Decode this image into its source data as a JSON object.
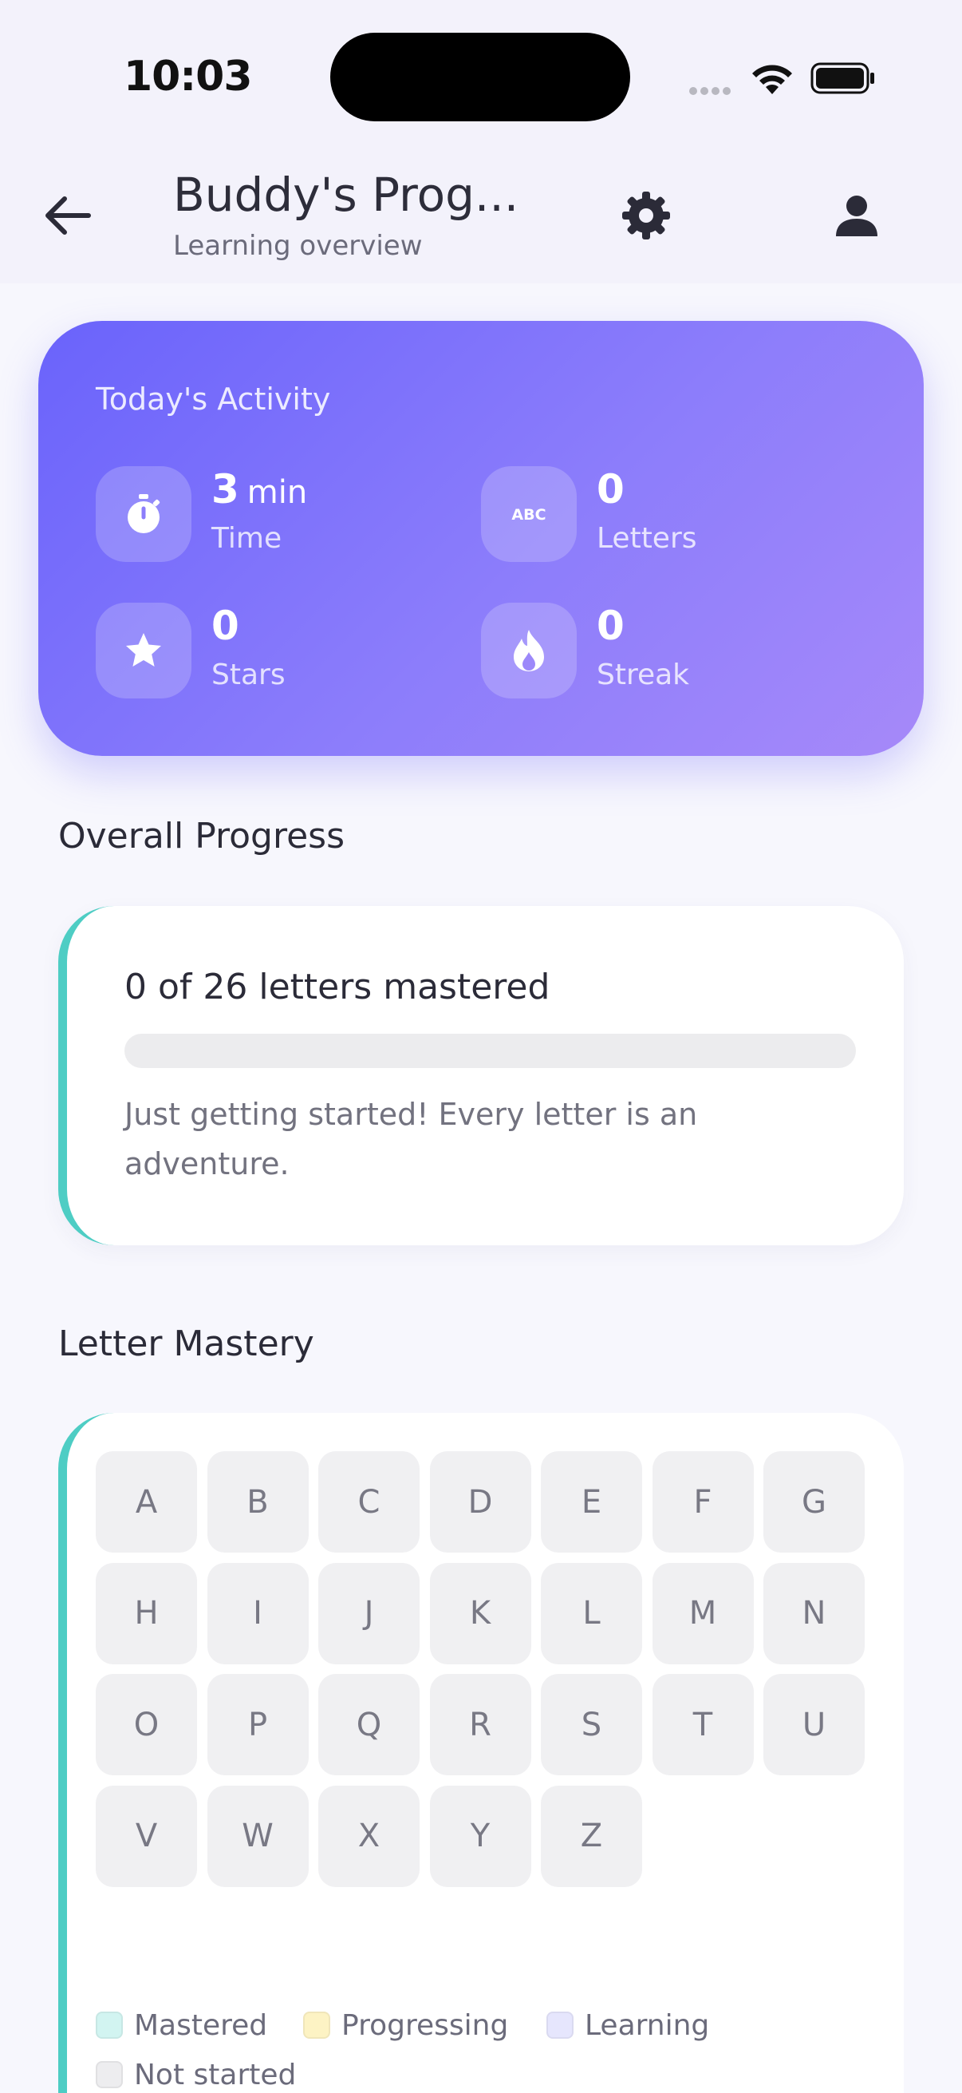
{
  "status_bar": {
    "time": "10:03"
  },
  "header": {
    "title": "Buddy's Prog...",
    "subtitle": "Learning overview"
  },
  "activity": {
    "title": "Today's Activity",
    "stats": [
      {
        "value": "3",
        "unit": "min",
        "label": "Time",
        "icon": "stopwatch-icon"
      },
      {
        "value": "0",
        "unit": "",
        "label": "Letters",
        "icon": "abc-icon"
      },
      {
        "value": "0",
        "unit": "",
        "label": "Stars",
        "icon": "star-icon"
      },
      {
        "value": "0",
        "unit": "",
        "label": "Streak",
        "icon": "flame-icon"
      }
    ]
  },
  "overall": {
    "section_title": "Overall Progress",
    "heading": "0 of 26 letters mastered",
    "mastered": 0,
    "total": 26,
    "description": "Just getting started! Every letter is an adventure."
  },
  "mastery": {
    "section_title": "Letter Mastery",
    "letters": [
      "A",
      "B",
      "C",
      "D",
      "E",
      "F",
      "G",
      "H",
      "I",
      "J",
      "K",
      "L",
      "M",
      "N",
      "O",
      "P",
      "Q",
      "R",
      "S",
      "T",
      "U",
      "V",
      "W",
      "X",
      "Y",
      "Z"
    ],
    "legend": [
      {
        "label": "Mastered",
        "color": "#d2f4f1"
      },
      {
        "label": "Progressing",
        "color": "#fdf3c4"
      },
      {
        "label": "Learning",
        "color": "#e6e6fd"
      },
      {
        "label": "Not started",
        "color": "#ededef"
      }
    ]
  },
  "colors": {
    "accent": "#6a63fb",
    "teal": "#4ecdc4",
    "tile": "#f0f0f2"
  }
}
